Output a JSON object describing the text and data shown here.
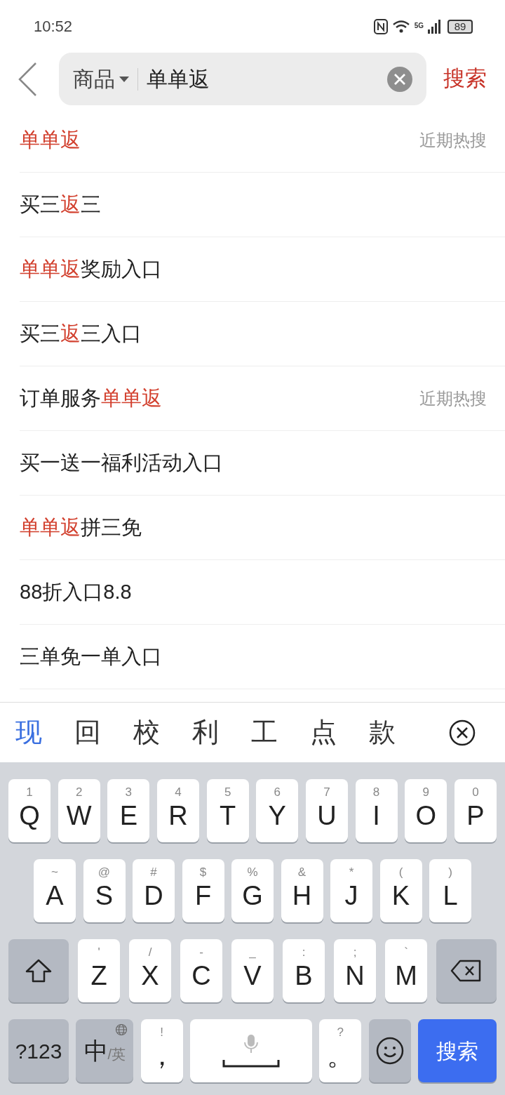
{
  "status_bar": {
    "time": "10:52",
    "network": "5G",
    "battery": "89"
  },
  "search_bar": {
    "scope": "商品",
    "value": "单单返",
    "button": "搜索"
  },
  "suggestions": [
    {
      "parts": [
        {
          "text": "单单返",
          "highlight": true
        }
      ],
      "tag": "近期热搜"
    },
    {
      "parts": [
        {
          "text": "买三",
          "highlight": false
        },
        {
          "text": "返",
          "highlight": true
        },
        {
          "text": "三",
          "highlight": false
        }
      ]
    },
    {
      "parts": [
        {
          "text": "单单返",
          "highlight": true
        },
        {
          "text": "奖励入口",
          "highlight": false
        }
      ]
    },
    {
      "parts": [
        {
          "text": "买三",
          "highlight": false
        },
        {
          "text": "返",
          "highlight": true
        },
        {
          "text": "三入口",
          "highlight": false
        }
      ]
    },
    {
      "parts": [
        {
          "text": "订单服务",
          "highlight": false
        },
        {
          "text": "单单返",
          "highlight": true
        }
      ],
      "tag": "近期热搜"
    },
    {
      "parts": [
        {
          "text": "买一送一福利活动入口",
          "highlight": false
        }
      ]
    },
    {
      "parts": [
        {
          "text": "单单返",
          "highlight": true
        },
        {
          "text": "拼三免",
          "highlight": false
        }
      ]
    },
    {
      "parts": [
        {
          "text": "88折入口8.8",
          "highlight": false
        }
      ]
    },
    {
      "parts": [
        {
          "text": "三单免一单入口",
          "highlight": false
        }
      ]
    }
  ],
  "candidates": [
    {
      "text": "现",
      "selected": true
    },
    {
      "text": "回",
      "selected": false
    },
    {
      "text": "校",
      "selected": false
    },
    {
      "text": "利",
      "selected": false
    },
    {
      "text": "工",
      "selected": false
    },
    {
      "text": "点",
      "selected": false
    },
    {
      "text": "款",
      "selected": false
    }
  ],
  "keyboard": [
    [
      {
        "kind": "char",
        "hint": "1",
        "label": "Q"
      },
      {
        "kind": "char",
        "hint": "2",
        "label": "W"
      },
      {
        "kind": "char",
        "hint": "3",
        "label": "E"
      },
      {
        "kind": "char",
        "hint": "4",
        "label": "R"
      },
      {
        "kind": "char",
        "hint": "5",
        "label": "T"
      },
      {
        "kind": "char",
        "hint": "6",
        "label": "Y"
      },
      {
        "kind": "char",
        "hint": "7",
        "label": "U"
      },
      {
        "kind": "char",
        "hint": "8",
        "label": "I"
      },
      {
        "kind": "char",
        "hint": "9",
        "label": "O"
      },
      {
        "kind": "char",
        "hint": "0",
        "label": "P"
      }
    ],
    [
      {
        "kind": "char",
        "hint": "~",
        "label": "A"
      },
      {
        "kind": "char",
        "hint": "@",
        "label": "S"
      },
      {
        "kind": "char",
        "hint": "#",
        "label": "D"
      },
      {
        "kind": "char",
        "hint": "$",
        "label": "F"
      },
      {
        "kind": "char",
        "hint": "%",
        "label": "G"
      },
      {
        "kind": "char",
        "hint": "&",
        "label": "H"
      },
      {
        "kind": "char",
        "hint": "*",
        "label": "J"
      },
      {
        "kind": "char",
        "hint": "(",
        "label": "K"
      },
      {
        "kind": "char",
        "hint": ")",
        "label": "L"
      }
    ],
    [
      {
        "kind": "shift"
      },
      {
        "kind": "char",
        "hint": "'",
        "label": "Z"
      },
      {
        "kind": "char",
        "hint": "/",
        "label": "X"
      },
      {
        "kind": "char",
        "hint": "-",
        "label": "C"
      },
      {
        "kind": "char",
        "hint": "_",
        "label": "V"
      },
      {
        "kind": "char",
        "hint": ":",
        "label": "B"
      },
      {
        "kind": "char",
        "hint": ";",
        "label": "N"
      },
      {
        "kind": "char",
        "hint": "`",
        "label": "M"
      },
      {
        "kind": "backspace"
      }
    ],
    [
      {
        "kind": "symbols",
        "label": "?123"
      },
      {
        "kind": "lang",
        "label": "中",
        "sub": "/英"
      },
      {
        "kind": "char",
        "hint": "!",
        "label": "，"
      },
      {
        "kind": "space"
      },
      {
        "kind": "char",
        "hint": "?",
        "label": "。"
      },
      {
        "kind": "emoji"
      },
      {
        "kind": "action",
        "label": "搜索"
      }
    ]
  ]
}
